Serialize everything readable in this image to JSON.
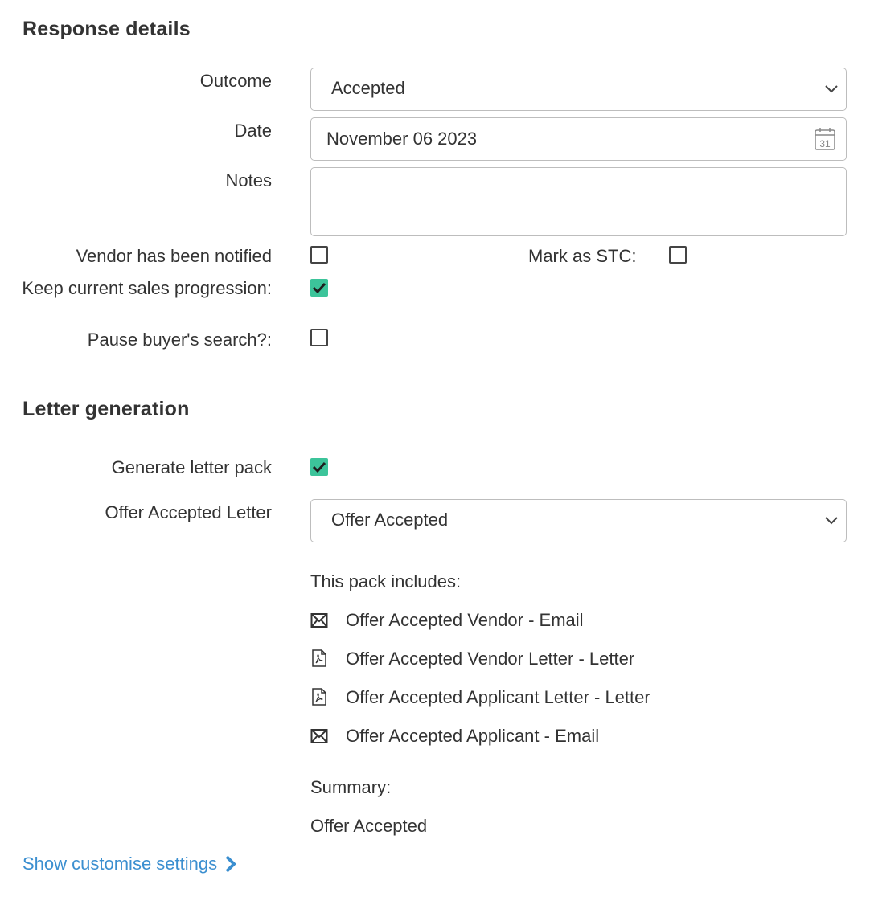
{
  "response_details": {
    "heading": "Response details",
    "outcome": {
      "label": "Outcome",
      "value": "Accepted"
    },
    "date": {
      "label": "Date",
      "value": "November 06 2023"
    },
    "notes": {
      "label": "Notes",
      "value": ""
    },
    "vendor_notified": {
      "label": "Vendor has been notified",
      "checked": false
    },
    "mark_stc": {
      "label": "Mark as STC:",
      "checked": false
    },
    "keep_progression": {
      "label": "Keep current sales progression:",
      "checked": true
    },
    "pause_search": {
      "label": "Pause buyer's search?:",
      "checked": false
    }
  },
  "letter_generation": {
    "heading": "Letter generation",
    "generate_pack": {
      "label": "Generate letter pack",
      "checked": true
    },
    "offer_letter": {
      "label": "Offer Accepted Letter",
      "value": "Offer Accepted"
    },
    "pack_includes_label": "This pack includes:",
    "pack_items": [
      {
        "icon": "envelope-icon",
        "text": "Offer Accepted Vendor - Email"
      },
      {
        "icon": "pdf-icon",
        "text": "Offer Accepted Vendor Letter - Letter"
      },
      {
        "icon": "pdf-icon",
        "text": "Offer Accepted Applicant Letter - Letter"
      },
      {
        "icon": "envelope-icon",
        "text": "Offer Accepted Applicant - Email"
      }
    ],
    "summary_label": "Summary:",
    "summary_value": "Offer Accepted"
  },
  "customise_link": "Show customise settings",
  "colors": {
    "accent_check": "#3cc49a",
    "link": "#3b8fd0"
  }
}
